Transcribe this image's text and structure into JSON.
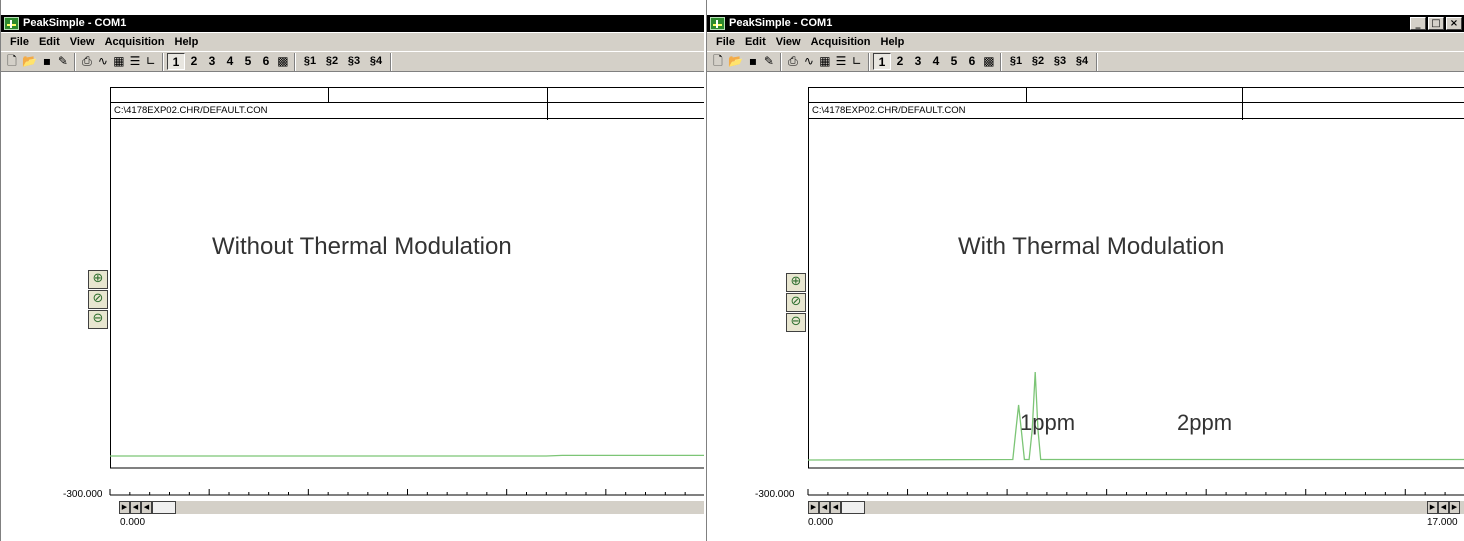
{
  "windows": [
    {
      "title": "PeakSimple - COM1",
      "menu": [
        "File",
        "Edit",
        "View",
        "Acquisition",
        "Help"
      ],
      "file_path": "C:\\4178EXP02.CHR/DEFAULT.CON",
      "annotation": "Without Thermal Modulation",
      "y_min_label": "-300.000",
      "x_start_label": "0.000",
      "x_end_label": "",
      "peak_labels": []
    },
    {
      "title": "PeakSimple - COM1",
      "menu": [
        "File",
        "Edit",
        "View",
        "Acquisition",
        "Help"
      ],
      "file_path": "C:\\4178EXP02.CHR/DEFAULT.CON",
      "annotation": "With Thermal Modulation",
      "y_min_label": "-300.000",
      "x_start_label": "0.000",
      "x_end_label": "17.000",
      "peak_labels": [
        "1ppm",
        "2ppm"
      ]
    }
  ],
  "toolbar": {
    "channel_buttons": [
      "1",
      "2",
      "3",
      "4",
      "5",
      "6"
    ],
    "group_buttons": [
      "§1",
      "§2",
      "§3",
      "§4"
    ],
    "icons": [
      "new-file-icon",
      "open-folder-icon",
      "save-icon",
      "postit-icon",
      "print-icon",
      "integration-icon",
      "results-table-icon",
      "component-list-icon",
      "axis-icon",
      "overlay-icon"
    ]
  },
  "window_controls": [
    "minimize-icon",
    "maximize-icon",
    "close-icon"
  ],
  "zoom_controls": [
    "zoom-in-icon",
    "zoom-reset-icon",
    "zoom-out-icon"
  ],
  "trace_color": "#7cc576",
  "chart_data": [
    {
      "type": "line",
      "series": [
        {
          "x": [
            0,
            5.5,
            5.7,
            7.5
          ],
          "y": [
            0,
            0,
            0.6,
            0.6
          ]
        }
      ],
      "xlim": [
        0,
        7.5
      ]
    },
    {
      "type": "line",
      "series": [
        {
          "x": [
            0,
            5.3,
            5.38,
            5.45,
            5.52,
            5.6,
            5.72,
            5.8,
            5.88,
            5.95,
            6.02,
            6.12,
            17
          ],
          "y": [
            0,
            0.5,
            30,
            55,
            30,
            0.5,
            0.5,
            30,
            88,
            30,
            0.5,
            0.5,
            0.5
          ]
        }
      ],
      "xlim": [
        0,
        17
      ]
    }
  ]
}
